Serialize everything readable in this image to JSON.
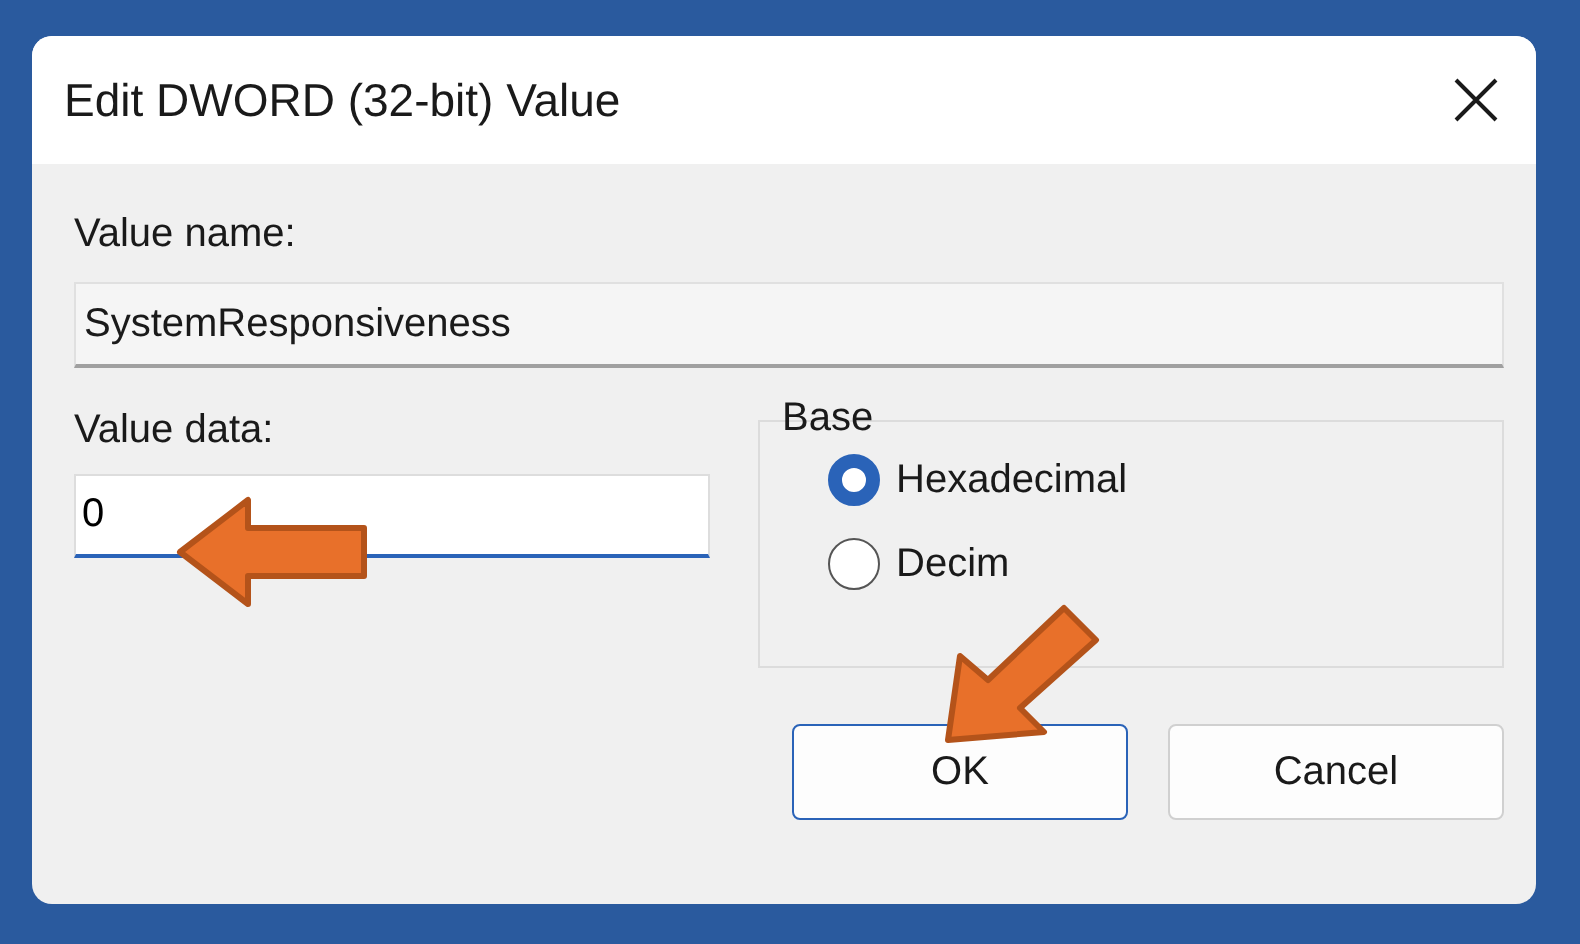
{
  "window": {
    "title": "Edit DWORD (32-bit) Value"
  },
  "value_name": {
    "label": "Value name:",
    "value": "SystemResponsiveness"
  },
  "value_data": {
    "label": "Value data:",
    "value": "0"
  },
  "base": {
    "label": "Base",
    "options": [
      {
        "label": "Hexadecimal",
        "selected": true
      },
      {
        "label": "Decim",
        "selected": false
      }
    ]
  },
  "buttons": [
    {
      "label": "OK",
      "default": true
    },
    {
      "label": "Cancel",
      "default": false
    }
  ]
}
